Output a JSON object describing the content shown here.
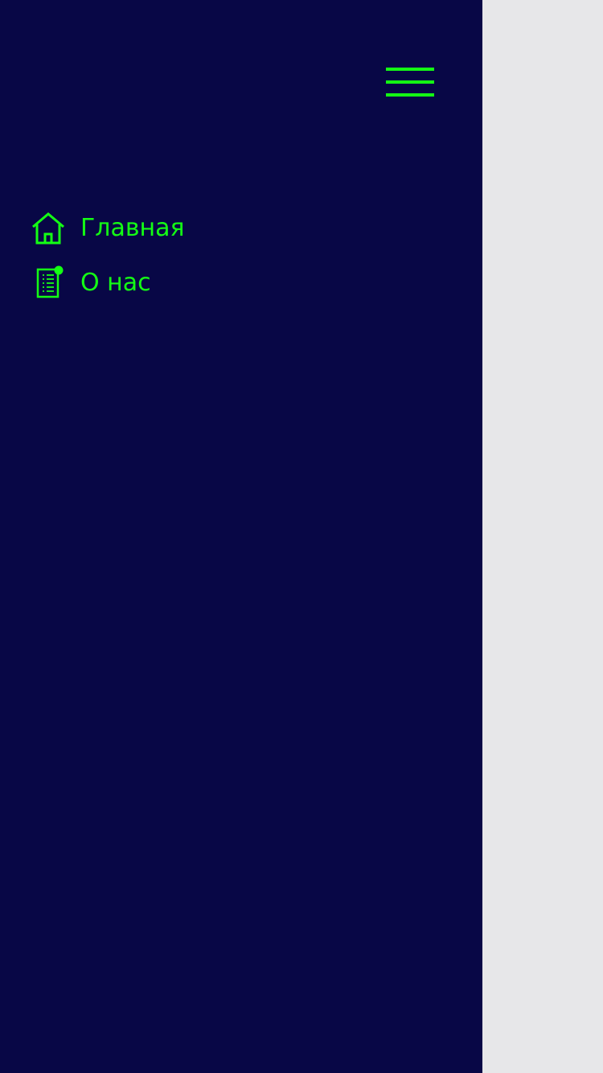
{
  "colors": {
    "drawer_background": "#080746",
    "page_background": "#e7e7e9",
    "accent": "#14ff14"
  },
  "header": {
    "menu_icon": "hamburger-menu-icon"
  },
  "sidebar": {
    "items": [
      {
        "label": "Главная",
        "icon": "home-icon"
      },
      {
        "label": "О нас",
        "icon": "document-icon"
      }
    ]
  }
}
